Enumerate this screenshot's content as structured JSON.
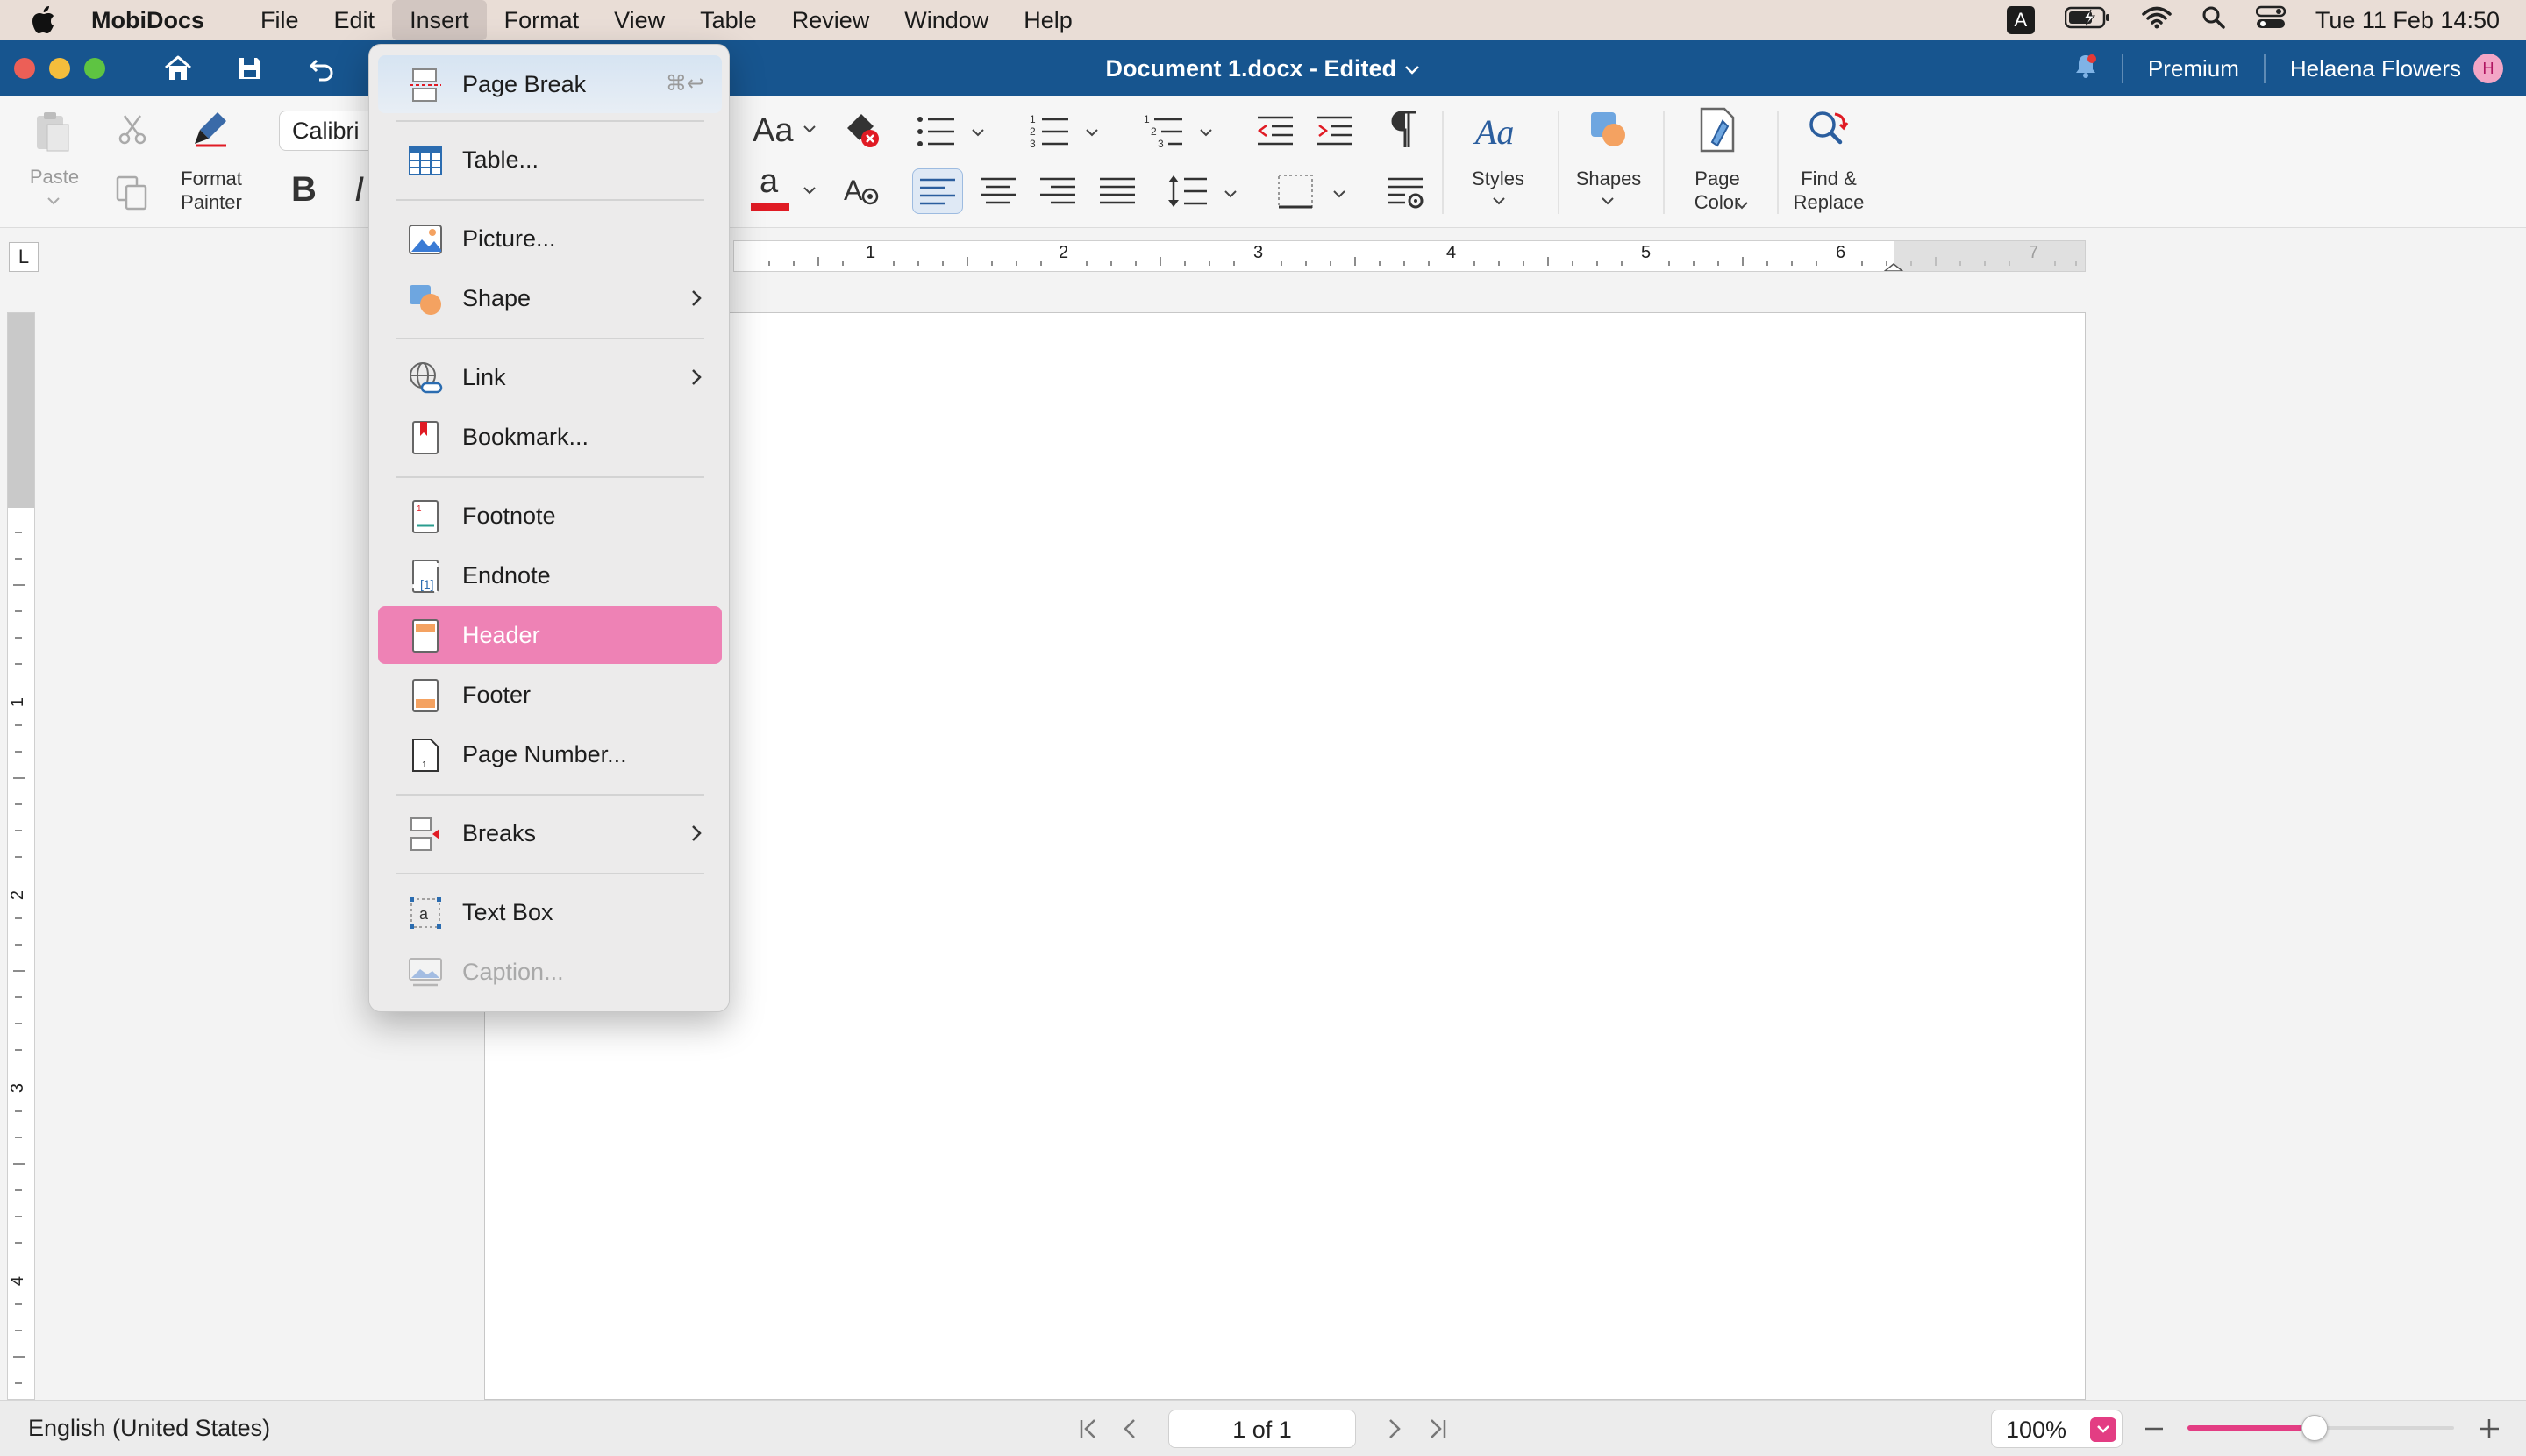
{
  "menubar": {
    "app_name": "MobiDocs",
    "items": [
      "File",
      "Edit",
      "Insert",
      "Format",
      "View",
      "Table",
      "Review",
      "Window",
      "Help"
    ],
    "active": "Insert",
    "input_badge": "A",
    "clock": "Tue 11 Feb  14:50"
  },
  "titlebar": {
    "title": "Document 1.docx - Edited",
    "premium": "Premium",
    "user": "Helaena Flowers",
    "avatar_initial": "H"
  },
  "ribbon": {
    "paste": "Paste",
    "format_painter_1": "Format",
    "format_painter_2": "Painter",
    "font": "Calibri",
    "bold": "B",
    "italic": "I",
    "case": "Aa",
    "font_color_glyph": "a",
    "styles": "Styles",
    "shapes": "Shapes",
    "page_color_1": "Page",
    "page_color_2": "Color",
    "find_replace_1": "Find &",
    "find_replace_2": "Replace",
    "accent_red": "#e01b24"
  },
  "ruler": {
    "numbers": [
      "1",
      "2",
      "3",
      "4",
      "5",
      "6",
      "7"
    ],
    "vertical_numbers": [
      "1",
      "2",
      "3",
      "4"
    ],
    "corner": "L"
  },
  "insert_menu": {
    "items": [
      {
        "label": "Page Break",
        "shortcut": "⌘↩"
      },
      {
        "label": "Table..."
      },
      {
        "label": "Picture..."
      },
      {
        "label": "Shape"
      },
      {
        "label": "Link"
      },
      {
        "label": "Bookmark..."
      },
      {
        "label": "Footnote"
      },
      {
        "label": "Endnote"
      },
      {
        "label": "Header"
      },
      {
        "label": "Footer"
      },
      {
        "label": "Page Number..."
      },
      {
        "label": "Breaks"
      },
      {
        "label": "Text Box"
      },
      {
        "label": "Caption..."
      }
    ],
    "highlight_color": "#ee82b5"
  },
  "statusbar": {
    "language": "English (United States)",
    "page": "1 of 1",
    "zoom": "100%"
  }
}
